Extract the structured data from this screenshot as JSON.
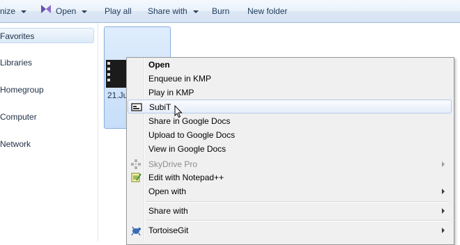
{
  "toolbar": {
    "organize": "nize",
    "open": "Open",
    "play_all": "Play all",
    "share_with": "Share with",
    "burn": "Burn",
    "new_folder": "New folder"
  },
  "nav": {
    "favorites": "Favorites",
    "libraries": "Libraries",
    "homegroup": "Homegroup",
    "computer": "Computer",
    "network": "Network"
  },
  "file": {
    "label": "21.Jun"
  },
  "menu": {
    "open": "Open",
    "enqueue_kmp": "Enqueue in KMP",
    "play_kmp": "Play in KMP",
    "subit": "SubiT",
    "share_gdocs": "Share in Google Docs",
    "upload_gdocs": "Upload to Google Docs",
    "view_gdocs": "View in Google Docs",
    "skydrive": "SkyDrive Pro",
    "notepad": "Edit with Notepad++",
    "open_with": "Open with",
    "share_with": "Share with",
    "tortoisegit": "TortoiseGit"
  },
  "colors": {
    "toolbar_bg": "#dce7f5",
    "selection_bg": "#c6def9",
    "menu_bg": "#f0f0f0",
    "hover_border": "#b3cbe9"
  }
}
